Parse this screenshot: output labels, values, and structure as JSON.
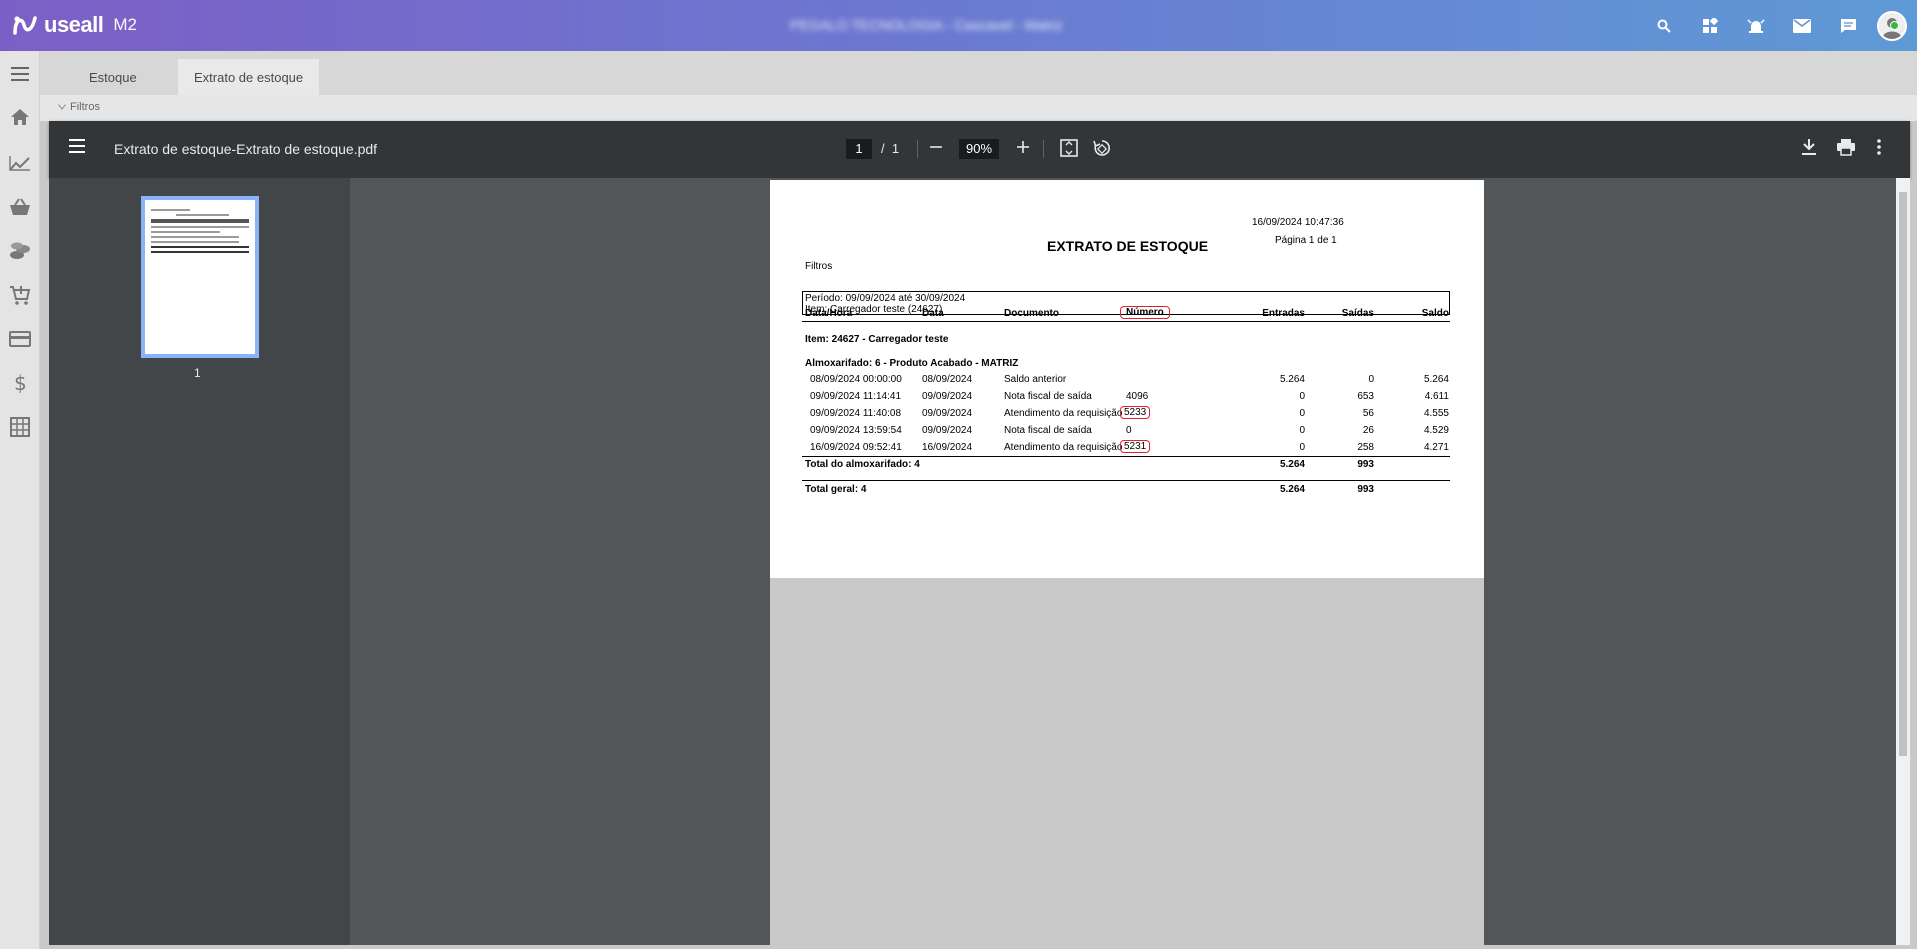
{
  "app": {
    "brand": "useall",
    "version_label": "M2",
    "blurred_header": "PEGALO TECNOLOGIA - Cascavel - Matriz"
  },
  "header_icons": [
    "search-icon",
    "apps-icon",
    "alarm-icon",
    "mail-icon",
    "chat-icon"
  ],
  "sidebar": {
    "items": [
      "menu-icon",
      "home-icon",
      "trend-icon",
      "basket-icon",
      "coins-icon",
      "cart-icon",
      "card-icon",
      "dollar-icon",
      "calculator-icon"
    ]
  },
  "tabs": [
    {
      "label": "Estoque"
    },
    {
      "label": "Extrato de estoque"
    }
  ],
  "filters": {
    "label": "Filtros"
  },
  "viewer": {
    "title": "Extrato de estoque-Extrato de estoque.pdf",
    "current_page": "1",
    "page_sep": "/",
    "total_pages": "1",
    "zoom": "90%",
    "thumb_label": "1"
  },
  "report": {
    "datetime": "16/09/2024 10:47:36",
    "title": "EXTRATO DE ESTOQUE",
    "page_info": "Página 1 de 1",
    "filters_label": "Filtros",
    "filter_period": "Período: 09/09/2024 até 30/09/2024",
    "filter_item": "Item: Carregador teste (24627)",
    "columns": [
      "Data/Hora",
      "Data",
      "Documento",
      "Número",
      "Entradas",
      "Saídas",
      "Saldo"
    ],
    "item_heading": "Item: 24627 - Carregador teste",
    "warehouse_heading": "Almoxarifado: 6 - Produto Acabado - MATRIZ",
    "rows": [
      {
        "datetime": "08/09/2024 00:00:00",
        "date": "08/09/2024",
        "document": "Saldo anterior",
        "number": "",
        "in": "5.264",
        "out": "0",
        "balance": "5.264"
      },
      {
        "datetime": "09/09/2024 11:14:41",
        "date": "09/09/2024",
        "document": "Nota fiscal de saída",
        "number": "4096",
        "in": "0",
        "out": "653",
        "balance": "4.611"
      },
      {
        "datetime": "09/09/2024 11:40:08",
        "date": "09/09/2024",
        "document": "Atendimento da requisição",
        "number": "5233",
        "in": "0",
        "out": "56",
        "balance": "4.555"
      },
      {
        "datetime": "09/09/2024 13:59:54",
        "date": "09/09/2024",
        "document": "Nota fiscal de saída",
        "number": "0",
        "in": "0",
        "out": "26",
        "balance": "4.529"
      },
      {
        "datetime": "16/09/2024 09:52:41",
        "date": "16/09/2024",
        "document": "Atendimento da requisição",
        "number": "5231",
        "in": "0",
        "out": "258",
        "balance": "4.271"
      }
    ],
    "warehouse_total_label": "Total do almoxarifado: 4",
    "warehouse_total_in": "5.264",
    "warehouse_total_out": "993",
    "grand_total_label": "Total geral: 4",
    "grand_total_in": "5.264",
    "grand_total_out": "993"
  }
}
